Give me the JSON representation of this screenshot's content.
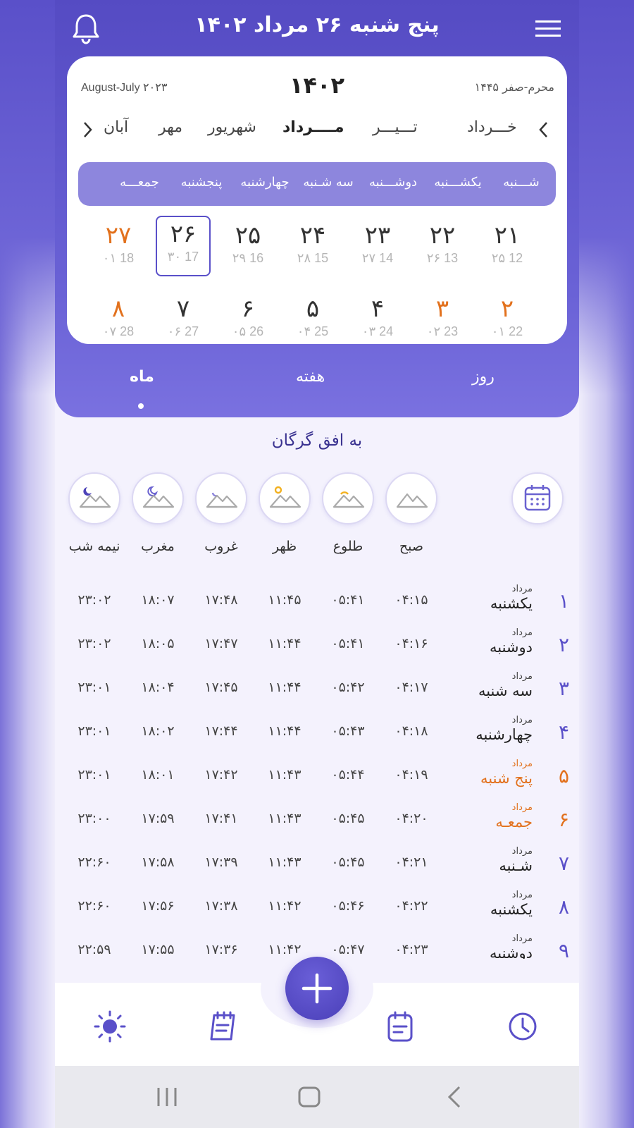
{
  "header": {
    "title": "پنج شنبه ۲۶ مرداد ۱۴۰۲",
    "menu_icon": "hamburger-menu-icon",
    "bell_icon": "bell-icon"
  },
  "calendar": {
    "gregorian_range": "August-July ۲۰۲۳",
    "year": "۱۴۰۲",
    "hijri_range": "محرم-صفر ۱۴۴۵",
    "months": [
      "خـــرداد",
      "تـــیـــر",
      "مــــرداد",
      "شهریور",
      "مهر",
      "آبان"
    ],
    "selected_month": "مــــرداد",
    "weekdays": [
      "شـــنبه",
      "یکشـــنبه",
      "دوشـــنبه",
      "سه شـنبه",
      "چهارشنبه",
      "پنجشنبه",
      "جمعـــه"
    ],
    "week1": [
      {
        "day": "۲۱",
        "greg": "12",
        "hijri": "۲۵"
      },
      {
        "day": "۲۲",
        "greg": "13",
        "hijri": "۲۶"
      },
      {
        "day": "۲۳",
        "greg": "14",
        "hijri": "۲۷"
      },
      {
        "day": "۲۴",
        "greg": "15",
        "hijri": "۲۸"
      },
      {
        "day": "۲۵",
        "greg": "16",
        "hijri": "۲۹"
      },
      {
        "day": "۲۶",
        "greg": "17",
        "hijri": "۳۰"
      },
      {
        "day": "۲۷",
        "greg": "18",
        "hijri": "۰۱"
      }
    ],
    "week2": [
      {
        "day": "۲",
        "greg": "22",
        "hijri": "۰۱"
      },
      {
        "day": "۳",
        "greg": "23",
        "hijri": "۰۲"
      },
      {
        "day": "۴",
        "greg": "24",
        "hijri": "۰۳"
      },
      {
        "day": "۵",
        "greg": "25",
        "hijri": "۰۴"
      },
      {
        "day": "۶",
        "greg": "26",
        "hijri": "۰۵"
      },
      {
        "day": "۷",
        "greg": "27",
        "hijri": "۰۶"
      },
      {
        "day": "۸",
        "greg": "28",
        "hijri": "۰۷"
      }
    ],
    "today_day": "۲۶"
  },
  "tabs": [
    "روز",
    "هفته",
    "ماه"
  ],
  "selected_tab": "ماه",
  "horizon_label": "به افق گرگان",
  "prayer_columns": [
    "صبح",
    "طلوع",
    "ظهر",
    "غروب",
    "مغرب",
    "نیمه شب"
  ],
  "prayer_icons": [
    "mountain-icon",
    "mountain-sunrise-icon",
    "mountain-sun-icon",
    "mountain-moonrise-icon",
    "mountain-moon-icon",
    "mountain-night-icon"
  ],
  "calendar_button_icon": "calendar-icon",
  "rows": [
    {
      "num": "۱",
      "month": "مرداد",
      "weekday": "یکشنبه",
      "times": [
        "۰۴:۱۵",
        "۰۵:۴۱",
        "۱۱:۴۵",
        "۱۷:۴۸",
        "۱۸:۰۷",
        "۲۳:۰۲"
      ]
    },
    {
      "num": "۲",
      "month": "مرداد",
      "weekday": "دوشنبه",
      "times": [
        "۰۴:۱۶",
        "۰۵:۴۱",
        "۱۱:۴۴",
        "۱۷:۴۷",
        "۱۸:۰۵",
        "۲۳:۰۲"
      ]
    },
    {
      "num": "۳",
      "month": "مرداد",
      "weekday": "سه شنبه",
      "times": [
        "۰۴:۱۷",
        "۰۵:۴۲",
        "۱۱:۴۴",
        "۱۷:۴۵",
        "۱۸:۰۴",
        "۲۳:۰۱"
      ]
    },
    {
      "num": "۴",
      "month": "مرداد",
      "weekday": "چهارشنبه",
      "times": [
        "۰۴:۱۸",
        "۰۵:۴۳",
        "۱۱:۴۴",
        "۱۷:۴۴",
        "۱۸:۰۲",
        "۲۳:۰۱"
      ]
    },
    {
      "num": "۵",
      "month": "مرداد",
      "weekday": "پنج شنبه",
      "times": [
        "۰۴:۱۹",
        "۰۵:۴۴",
        "۱۱:۴۳",
        "۱۷:۴۲",
        "۱۸:۰۱",
        "۲۳:۰۱"
      ]
    },
    {
      "num": "۶",
      "month": "مرداد",
      "weekday": "جمعـه",
      "times": [
        "۰۴:۲۰",
        "۰۵:۴۵",
        "۱۱:۴۳",
        "۱۷:۴۱",
        "۱۷:۵۹",
        "۲۳:۰۰"
      ]
    },
    {
      "num": "۷",
      "month": "مرداد",
      "weekday": "شـنبه",
      "times": [
        "۰۴:۲۱",
        "۰۵:۴۵",
        "۱۱:۴۳",
        "۱۷:۳۹",
        "۱۷:۵۸",
        "۲۲:۶۰"
      ]
    },
    {
      "num": "۸",
      "month": "مرداد",
      "weekday": "یکشنبه",
      "times": [
        "۰۴:۲۲",
        "۰۵:۴۶",
        "۱۱:۴۲",
        "۱۷:۳۸",
        "۱۷:۵۶",
        "۲۲:۶۰"
      ]
    },
    {
      "num": "۹",
      "month": "مرداد",
      "weekday": "دوشنبه",
      "times": [
        "۰۴:۲۳",
        "۰۵:۴۷",
        "۱۱:۴۲",
        "۱۷:۳۶",
        "۱۷:۵۵",
        "۲۲:۵۹"
      ]
    }
  ],
  "highlight_rows": [
    "۵",
    "۶"
  ],
  "bottom_nav": [
    "clock-icon",
    "calendar-notes-icon",
    "add-icon",
    "notepad-icon",
    "sun-icon"
  ],
  "system_nav": [
    "back-icon",
    "home-icon",
    "recents-icon"
  ],
  "colors": {
    "primary": "#5a50c9",
    "accent": "#e2711d",
    "weekbar": "#8d86dd"
  }
}
